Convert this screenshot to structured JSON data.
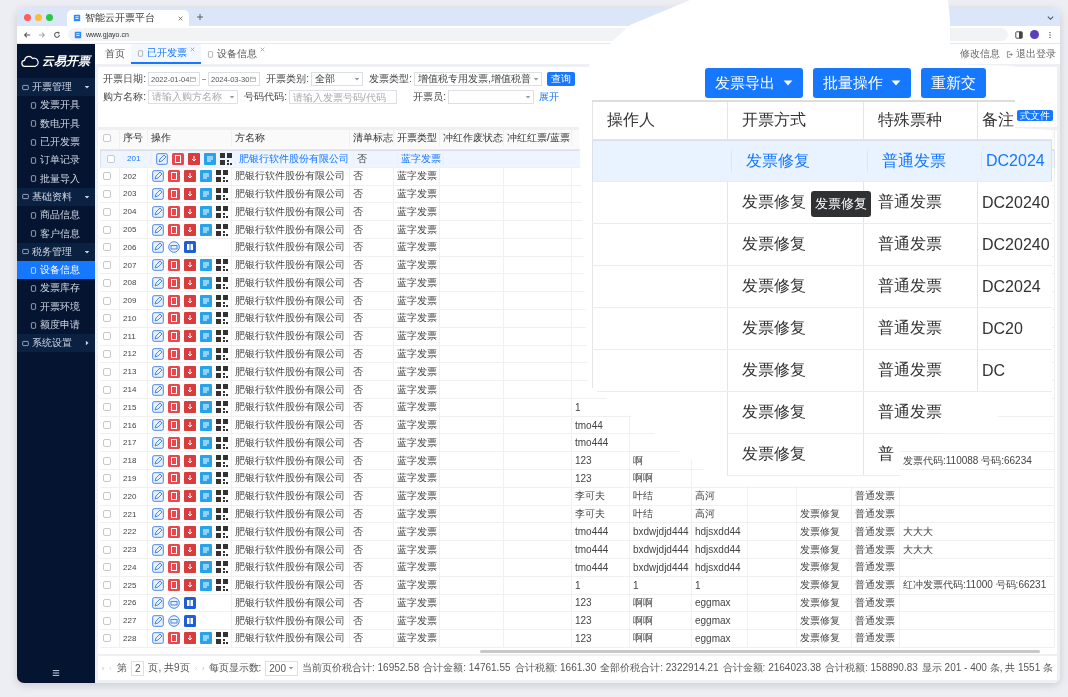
{
  "browser": {
    "tab_title": "智能云开票平台",
    "url": "www.gjayo.cn"
  },
  "sidebar": {
    "logo": "云易开票",
    "groups": [
      {
        "label": "开票管理",
        "expanded": true,
        "children": [
          {
            "label": "发票开具",
            "selected": false
          },
          {
            "label": "数电开具",
            "selected": false
          },
          {
            "label": "已开发票",
            "selected": false
          },
          {
            "label": "订单记录",
            "selected": false
          },
          {
            "label": "批量导入",
            "selected": false
          }
        ]
      },
      {
        "label": "基础资料",
        "expanded": true,
        "children": [
          {
            "label": "商品信息",
            "selected": false
          },
          {
            "label": "客户信息",
            "selected": false
          }
        ]
      },
      {
        "label": "税务管理",
        "expanded": true,
        "children": [
          {
            "label": "设备信息",
            "selected": true
          },
          {
            "label": "发票库存",
            "selected": false
          },
          {
            "label": "开票环境",
            "selected": false
          },
          {
            "label": "额度申请",
            "selected": false
          }
        ]
      },
      {
        "label": "系统设置",
        "expanded": false
      }
    ]
  },
  "topbar": {
    "tabs": [
      {
        "label": "首页",
        "selected": false,
        "closable": false
      },
      {
        "label": "已开发票",
        "selected": true,
        "closable": true
      },
      {
        "label": "设备信息",
        "selected": false,
        "closable": true
      }
    ],
    "links": [
      "修改信息",
      "退出登录"
    ]
  },
  "filters": {
    "rows": [
      [
        {
          "label": "开票日期:",
          "kind": "date_range",
          "from": "2022-01-04",
          "to": "2024-03-30"
        },
        {
          "label": "开票类别:",
          "kind": "select",
          "value": "全部"
        },
        {
          "label": "发票类型:",
          "kind": "select",
          "value": "增值税专用发票,增值税普"
        }
      ],
      [
        {
          "label": "购方名称:",
          "kind": "select",
          "placeholder": "请输入购方名称"
        },
        {
          "label": "号码代码:",
          "kind": "input",
          "placeholder": "请输入发票号码/代码"
        },
        {
          "label": "开票员:",
          "kind": "select"
        }
      ]
    ],
    "search_button": "查询",
    "expand_link": "展开",
    "side_button": "式文件"
  },
  "table": {
    "header_checked": false,
    "columns": [
      "序号",
      "操作",
      "方名称",
      "清单标志",
      "开票类型",
      "冲红作废状态",
      "冲红红票/蓝票"
    ],
    "rows": [
      {
        "no": "201",
        "checked": false,
        "selected": true,
        "kind": "full",
        "company": "肥银行软件股份有限公司",
        "list_flag": "否",
        "type": "蓝字发票"
      },
      {
        "no": "202",
        "checked": false,
        "selected": false,
        "kind": "full",
        "company": "肥银行软件股份有限公司",
        "list_flag": "否",
        "type": "蓝字发票"
      },
      {
        "no": "203",
        "checked": false,
        "selected": false,
        "kind": "full",
        "company": "肥银行软件股份有限公司",
        "list_flag": "否",
        "type": "蓝字发票"
      },
      {
        "no": "204",
        "checked": false,
        "selected": false,
        "kind": "full",
        "company": "肥银行软件股份有限公司",
        "list_flag": "否",
        "type": "蓝字发票"
      },
      {
        "no": "205",
        "checked": false,
        "selected": false,
        "kind": "full",
        "company": "肥银行软件股份有限公司",
        "list_flag": "否",
        "type": "蓝字发票"
      },
      {
        "no": "206",
        "checked": false,
        "selected": false,
        "kind": "short",
        "company": "肥银行软件股份有限公司",
        "list_flag": "否",
        "type": "蓝字发票"
      },
      {
        "no": "207",
        "checked": false,
        "selected": false,
        "kind": "full",
        "company": "肥银行软件股份有限公司",
        "list_flag": "否",
        "type": "蓝字发票"
      },
      {
        "no": "208",
        "checked": false,
        "selected": false,
        "kind": "full",
        "company": "肥银行软件股份有限公司",
        "list_flag": "否",
        "type": "蓝字发票"
      },
      {
        "no": "209",
        "checked": false,
        "selected": false,
        "kind": "full",
        "company": "肥银行软件股份有限公司",
        "list_flag": "否",
        "type": "蓝字发票"
      },
      {
        "no": "210",
        "checked": false,
        "selected": false,
        "kind": "full",
        "company": "肥银行软件股份有限公司",
        "list_flag": "否",
        "type": "蓝字发票"
      },
      {
        "no": "211",
        "checked": false,
        "selected": false,
        "kind": "full",
        "company": "肥银行软件股份有限公司",
        "list_flag": "否",
        "type": "蓝字发票"
      },
      {
        "no": "212",
        "checked": false,
        "selected": false,
        "kind": "full",
        "company": "肥银行软件股份有限公司",
        "list_flag": "否",
        "type": "蓝字发票"
      },
      {
        "no": "213",
        "checked": false,
        "selected": false,
        "kind": "full",
        "company": "肥银行软件股份有限公司",
        "list_flag": "否",
        "type": "蓝字发票"
      },
      {
        "no": "214",
        "checked": false,
        "selected": false,
        "kind": "full",
        "company": "肥银行软件股份有限公司",
        "list_flag": "否",
        "type": "蓝字发票"
      },
      {
        "no": "215",
        "checked": false,
        "selected": false,
        "kind": "full",
        "company": "肥银行软件股份有限公司",
        "list_flag": "否",
        "type": "蓝字发票",
        "a": "1"
      },
      {
        "no": "216",
        "checked": false,
        "selected": false,
        "kind": "full",
        "company": "肥银行软件股份有限公司",
        "list_flag": "否",
        "type": "蓝字发票",
        "a": "tmo44"
      },
      {
        "no": "217",
        "checked": false,
        "selected": false,
        "kind": "full",
        "company": "肥银行软件股份有限公司",
        "list_flag": "否",
        "type": "蓝字发票",
        "a": "tmo444"
      },
      {
        "no": "218",
        "checked": false,
        "selected": false,
        "kind": "full",
        "company": "肥银行软件股份有限公司",
        "list_flag": "否",
        "type": "蓝字发票",
        "a": "123",
        "b": "啊",
        "remark": "发票代码:110088 号码:66234"
      },
      {
        "no": "219",
        "checked": false,
        "selected": false,
        "kind": "full",
        "company": "肥银行软件股份有限公司",
        "list_flag": "否",
        "type": "蓝字发票",
        "a": "123",
        "b": "啊啊"
      },
      {
        "no": "220",
        "checked": false,
        "selected": false,
        "kind": "full",
        "company": "肥银行软件股份有限公司",
        "list_flag": "否",
        "type": "蓝字发票",
        "a": "李可夫",
        "b": "叶结",
        "c": "高河",
        "special": "普通发票"
      },
      {
        "no": "221",
        "checked": false,
        "selected": false,
        "kind": "full",
        "company": "肥银行软件股份有限公司",
        "list_flag": "否",
        "type": "蓝字发票",
        "a": "李可夫",
        "b": "叶结",
        "c": "高河",
        "method": "发票修复",
        "special": "普通发票"
      },
      {
        "no": "222",
        "checked": false,
        "selected": false,
        "kind": "full",
        "company": "肥银行软件股份有限公司",
        "list_flag": "否",
        "type": "蓝字发票",
        "a": "tmo444",
        "b": "bxdwjdjd444",
        "c": "hdjsxdd44",
        "method": "发票修复",
        "special": "普通发票",
        "remark": "大大大"
      },
      {
        "no": "223",
        "checked": false,
        "selected": false,
        "kind": "full",
        "company": "肥银行软件股份有限公司",
        "list_flag": "否",
        "type": "蓝字发票",
        "a": "tmo444",
        "b": "bxdwjdjd444",
        "c": "hdjsxdd44",
        "method": "发票修复",
        "special": "普通发票",
        "remark": "大大大"
      },
      {
        "no": "224",
        "checked": false,
        "selected": false,
        "kind": "full",
        "company": "肥银行软件股份有限公司",
        "list_flag": "否",
        "type": "蓝字发票",
        "a": "tmo444",
        "b": "bxdwjdjd444",
        "c": "hdjsxdd44",
        "method": "发票修复",
        "special": "普通发票"
      },
      {
        "no": "225",
        "checked": false,
        "selected": false,
        "kind": "full",
        "company": "肥银行软件股份有限公司",
        "list_flag": "否",
        "type": "蓝字发票",
        "a": "1",
        "b": "1",
        "c": "1",
        "method": "发票修复",
        "special": "普通发票",
        "remark": "红冲发票代码:11000 号码:66231"
      },
      {
        "no": "226",
        "checked": false,
        "selected": false,
        "kind": "short",
        "company": "肥银行软件股份有限公司",
        "list_flag": "否",
        "type": "蓝字发票",
        "a": "123",
        "b": "啊啊",
        "c": "eggmax",
        "method": "发票修复",
        "special": "普通发票"
      },
      {
        "no": "227",
        "checked": false,
        "selected": false,
        "kind": "short",
        "company": "肥银行软件股份有限公司",
        "list_flag": "否",
        "type": "蓝字发票",
        "a": "123",
        "b": "啊啊",
        "c": "eggmax",
        "method": "发票修复",
        "special": "普通发票"
      },
      {
        "no": "228",
        "checked": false,
        "selected": false,
        "kind": "full",
        "company": "肥银行软件股份有限公司",
        "list_flag": "否",
        "type": "蓝字发票",
        "a": "123",
        "b": "啊啊",
        "c": "eggmax",
        "method": "发票修复",
        "special": "普通发票"
      }
    ]
  },
  "footer": {
    "page_label": "第",
    "page": "2",
    "page_total": "页, 共9页",
    "page_size_label": "每页显示数:",
    "page_size": "200",
    "sums": [
      "当前页价税合计: 16952.58",
      "合计金额: 14761.55",
      "合计税额: 1661.30",
      "全部价税合计: 2322914.21",
      "合计金额: 2164023.38",
      "合计税额: 158890.83"
    ],
    "range": "显示 201 - 400 条, 共 1551 条"
  },
  "magnifier": {
    "buttons": [
      {
        "label": "发票导出",
        "caret": true
      },
      {
        "label": "批量操作",
        "caret": true
      },
      {
        "label": "重新交",
        "caret": false
      }
    ],
    "columns": [
      "操作人",
      "开票方式",
      "特殊票种",
      "备注"
    ],
    "rows": [
      {
        "selected": true,
        "method": "发票修复",
        "special": "普通发票",
        "remark": "DC2024"
      },
      {
        "selected": false,
        "method": "发票修复",
        "special": "普通发票",
        "remark": "DC20240"
      },
      {
        "selected": false,
        "method": "发票修复",
        "special": "普通发票",
        "remark": "DC20240"
      },
      {
        "selected": false,
        "method": "发票修复",
        "special": "普通发票",
        "remark": "DC2024"
      },
      {
        "selected": false,
        "method": "发票修复",
        "special": "普通发票",
        "remark": "DC20"
      },
      {
        "selected": false,
        "method": "发票修复",
        "special": "普通发票",
        "remark": "DC"
      },
      {
        "selected": false,
        "method": "发票修复",
        "special": "普通发票"
      },
      {
        "selected": false,
        "method": "发票修复",
        "special": "普"
      }
    ],
    "tooltip": "发票修复"
  }
}
